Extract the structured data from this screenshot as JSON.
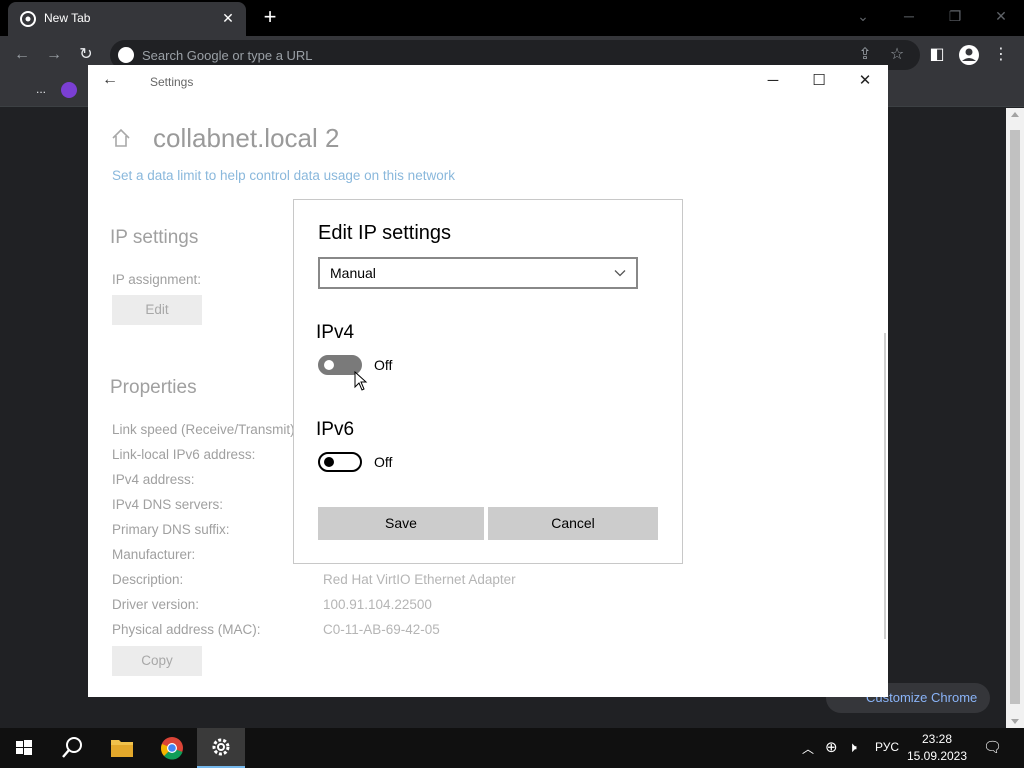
{
  "browser": {
    "tab_title": "New Tab",
    "omnibox_placeholder": "Search Google or type a URL",
    "bookmark_overflow": "...",
    "customize_label": "Customize Chrome"
  },
  "settings_window": {
    "title": "Settings",
    "network_name": "collabnet.local 2",
    "data_limit_link": "Set a data limit to help control data usage on this network",
    "ip_settings_heading": "IP settings",
    "ip_assignment_label": "IP assignment:",
    "edit_button": "Edit",
    "properties_heading": "Properties",
    "properties": [
      {
        "label": "Link speed (Receive/Transmit):",
        "value": ""
      },
      {
        "label": "Link-local IPv6 address:",
        "value": ""
      },
      {
        "label": "IPv4 address:",
        "value": ""
      },
      {
        "label": "IPv4 DNS servers:",
        "value": ""
      },
      {
        "label": "Primary DNS suffix:",
        "value": ""
      },
      {
        "label": "Manufacturer:",
        "value": ""
      },
      {
        "label": "Description:",
        "value": "Red Hat VirtIO Ethernet Adapter"
      },
      {
        "label": "Driver version:",
        "value": "100.91.104.22500"
      },
      {
        "label": "Physical address (MAC):",
        "value": "C0-11-AB-69-42-05"
      }
    ],
    "copy_button": "Copy"
  },
  "dialog": {
    "title": "Edit IP settings",
    "mode_selected": "Manual",
    "ipv4_heading": "IPv4",
    "ipv4_state": "Off",
    "ipv6_heading": "IPv6",
    "ipv6_state": "Off",
    "save_button": "Save",
    "cancel_button": "Cancel"
  },
  "taskbar": {
    "language": "РУС",
    "time": "23:28",
    "date": "15.09.2023"
  },
  "colors": {
    "dialog_button": "#cccccc",
    "link": "#8ab8dc",
    "taskbar": "#101010",
    "chrome_dark": "#35363a"
  }
}
